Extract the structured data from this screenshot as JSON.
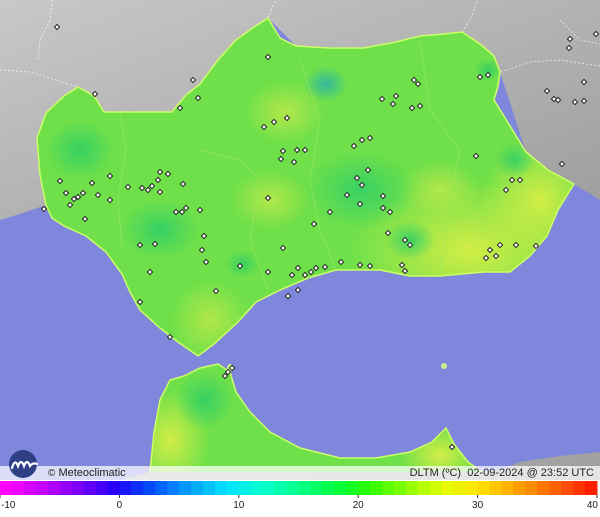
{
  "brand": {
    "name": "Meteoclimatic",
    "copyright_symbol": "©",
    "logo_icon": "meteoclimatic-logo-icon"
  },
  "caption": {
    "variable": "DLTM (ºC)",
    "date": "02-09-2024",
    "at": "@",
    "time": "23:52 UTC"
  },
  "colors": {
    "sea": "#7f87dd",
    "land_outside": "#b9b9b9",
    "region_base": "#6fe04a",
    "region_border": "#ccff66",
    "station_marker": "#ffffff"
  },
  "color_scale": {
    "min": -10,
    "max": 40,
    "tick_labels": [
      "-10",
      "0",
      "10",
      "20",
      "30",
      "40"
    ],
    "stops": [
      "#ff00ff",
      "#c400ff",
      "#7a00ff",
      "#2400ff",
      "#0050ff",
      "#00a0ff",
      "#00e0ff",
      "#00ffd0",
      "#00ff8c",
      "#00ff40",
      "#30ff00",
      "#90ff00",
      "#e8ff00",
      "#ffe000",
      "#ffa000",
      "#ff6400",
      "#ff2000"
    ]
  },
  "map_labels": []
}
